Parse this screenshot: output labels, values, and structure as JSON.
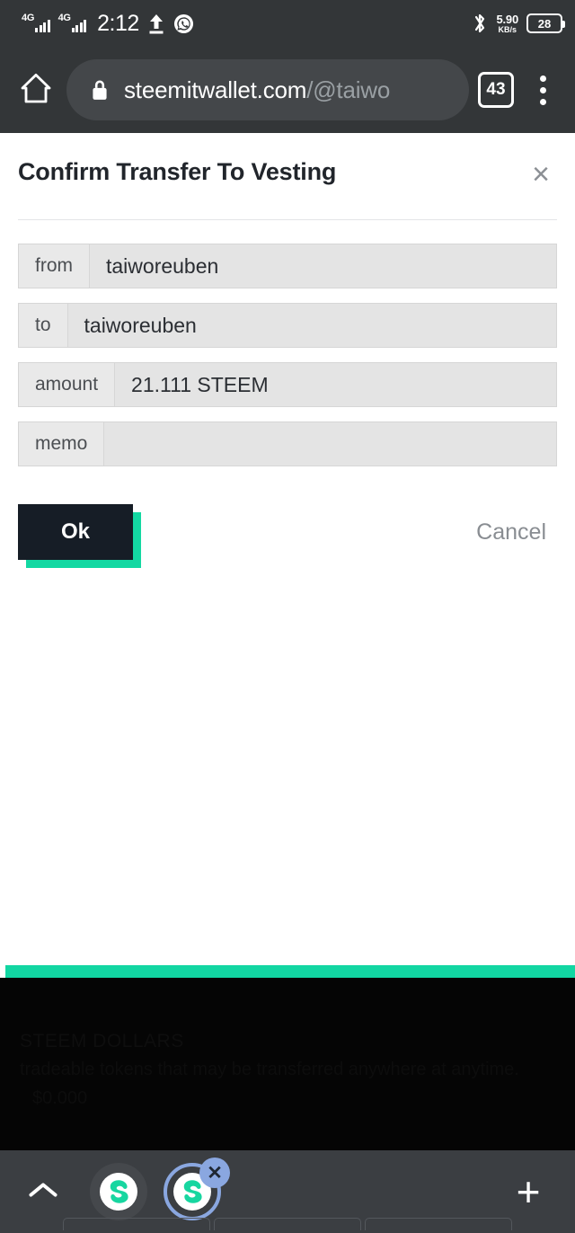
{
  "status_bar": {
    "network_1": "4G",
    "network_2": "4G",
    "time": "2:12",
    "upload_icon": "upload-arrow-icon",
    "whatsapp_icon": "whatsapp-icon",
    "bluetooth_icon": "bluetooth-icon",
    "net_speed_value": "5.90",
    "net_speed_unit": "KB/s",
    "battery_percent": "28"
  },
  "browser": {
    "home_icon": "home-icon",
    "lock_icon": "lock-icon",
    "url_domain": "steemitwallet.com",
    "url_path": "/@taiwo",
    "tab_count": "43",
    "menu_icon": "kebab-menu-icon"
  },
  "dialog": {
    "title": "Confirm Transfer To Vesting",
    "close_label": "×",
    "rows": [
      {
        "label": "from",
        "value": "taiworeuben"
      },
      {
        "label": "to",
        "value": "taiworeuben"
      },
      {
        "label": "amount",
        "value": "21.111 STEEM"
      },
      {
        "label": "memo",
        "value": ""
      }
    ],
    "ok_label": "Ok",
    "cancel_label": "Cancel",
    "accent_color": "#12d6a2",
    "ok_bg_color": "#161d26"
  },
  "background_page": {
    "section_title": "STEEM DOLLARS",
    "section_desc": "tradeable tokens that may be transferred anywhere at anytime.",
    "section_amount": "$0.000"
  },
  "tabbar": {
    "expand_icon": "chevron-up-icon",
    "tabs": [
      {
        "icon": "steemit-logo-icon",
        "selected": false
      },
      {
        "icon": "steemit-logo-icon",
        "selected": true,
        "close_label": "✕"
      }
    ],
    "new_tab_label": "+"
  }
}
